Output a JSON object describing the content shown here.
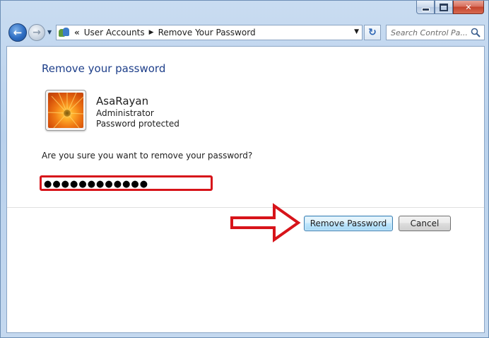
{
  "window": {
    "caption_buttons": [
      "minimize-icon",
      "maximize-icon",
      "close-icon"
    ],
    "close_glyph": "✕"
  },
  "nav": {
    "back_glyph": "←",
    "forward_glyph": "→",
    "history_dropdown_glyph": "▼"
  },
  "address": {
    "overflow_chevron": "«",
    "crumbs": [
      "User Accounts",
      "Remove Your Password"
    ],
    "separator_glyph": "▶",
    "dropdown_glyph": "▼",
    "refresh_glyph": "↻"
  },
  "search": {
    "placeholder": "Search Control Pa..."
  },
  "page": {
    "title": "Remove your password",
    "user_name": "AsaRayan",
    "user_role": "Administrator",
    "user_status": "Password protected",
    "question": "Are you sure you want to remove your password?",
    "password_value": "●●●●●●●●●●●●"
  },
  "buttons": {
    "remove_label": "Remove Password",
    "cancel_label": "Cancel"
  },
  "colors": {
    "title_blue": "#1e3f8a",
    "highlight_red": "#d7141a",
    "arrow_red": "#d7141a"
  }
}
